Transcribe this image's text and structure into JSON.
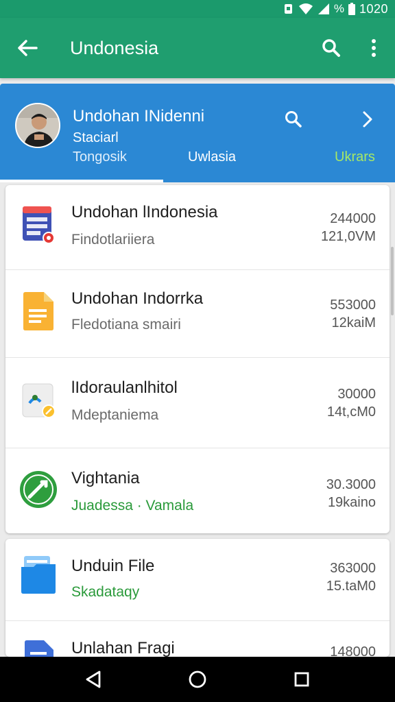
{
  "status_bar": {
    "battery_percent": "%",
    "time": "1020",
    "icons": [
      "notification-icon",
      "wifi-icon",
      "signal-icon",
      "battery-icon"
    ]
  },
  "app_bar": {
    "title": "Undonesia",
    "icons": [
      "back-arrow-icon",
      "search-icon",
      "more-vert-icon"
    ]
  },
  "profile": {
    "name": "Undohan INidenni",
    "subtitle": "Staciarl",
    "tabs": [
      "Tongosik",
      "Uwlasia",
      "Ukrars"
    ],
    "active_tab": 0,
    "colors": {
      "card": "#2b88d4",
      "highlight_tab": "#a6e866"
    }
  },
  "files": [
    {
      "name": "Undohan lIndonesia",
      "sub": "Findotlariiera",
      "value1": "244000",
      "value2": "121,0VM",
      "icon": "form-doc-icon",
      "sub_color": "gray"
    },
    {
      "name": "Undohan Indorrka",
      "sub": "Fledotiana smairi",
      "value1": "553000",
      "value2": "12kaiM",
      "icon": "docs-file-icon",
      "sub_color": "gray"
    },
    {
      "name": "lIdoraulanlhitol",
      "sub": "Mdeptaniema",
      "value1": "30000",
      "value2": "14t,cM0",
      "icon": "photo-file-icon",
      "sub_color": "gray"
    },
    {
      "name": "Vightania",
      "sub": "Juadessa · Vamala",
      "value1": "30.3000",
      "value2": "19kaino",
      "icon": "phone-app-icon",
      "sub_color": "green"
    },
    {
      "name": "Unduin File",
      "sub": "Skadataqy",
      "value1": "363000",
      "value2": "15.taM0",
      "icon": "folder-icon",
      "sub_color": "green"
    },
    {
      "name": "Unlahan Fragi",
      "sub": "",
      "value1": "148000",
      "value2": "",
      "icon": "doc-file-icon",
      "sub_color": "gray"
    }
  ],
  "nav_bar": {
    "icons": [
      "back-triangle-icon",
      "home-circle-icon",
      "recents-square-icon"
    ]
  },
  "colors": {
    "app_bar": "#1f9e6f",
    "status_bar": "#1b9a6c",
    "accent_green": "#2a9a3a"
  }
}
